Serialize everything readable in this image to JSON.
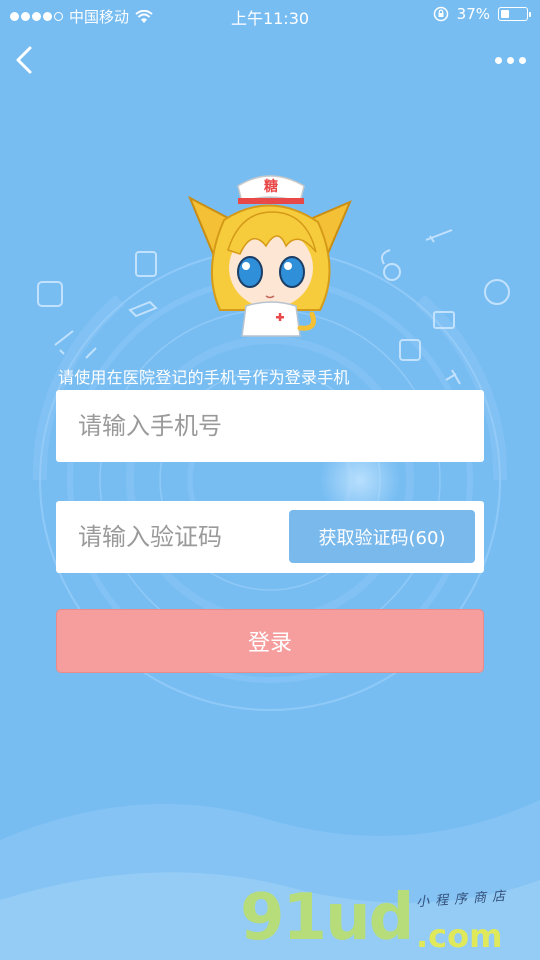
{
  "status_bar": {
    "carrier": "中国移动",
    "time": "上午11:30",
    "battery_text": "37%",
    "battery_level": 0.37
  },
  "nav": {
    "back_icon": "chevron-left-icon",
    "more_icon": "more-dots-icon"
  },
  "mascot": {
    "hat_text": "糖"
  },
  "form": {
    "hint": "请使用在医院登记的手机号作为登录手机",
    "phone_placeholder": "请输入手机号",
    "phone_value": "",
    "code_placeholder": "请输入验证码",
    "code_value": "",
    "get_code_label": "获取验证码(60)",
    "login_label": "登录"
  },
  "watermark": {
    "logo": "91ud",
    "domain": ".com",
    "tagline": "小程序商店"
  },
  "colors": {
    "background": "#78bdf2",
    "code_button": "#7ab9ec",
    "login_button": "#f69d9d",
    "input_bg": "#ffffff"
  }
}
